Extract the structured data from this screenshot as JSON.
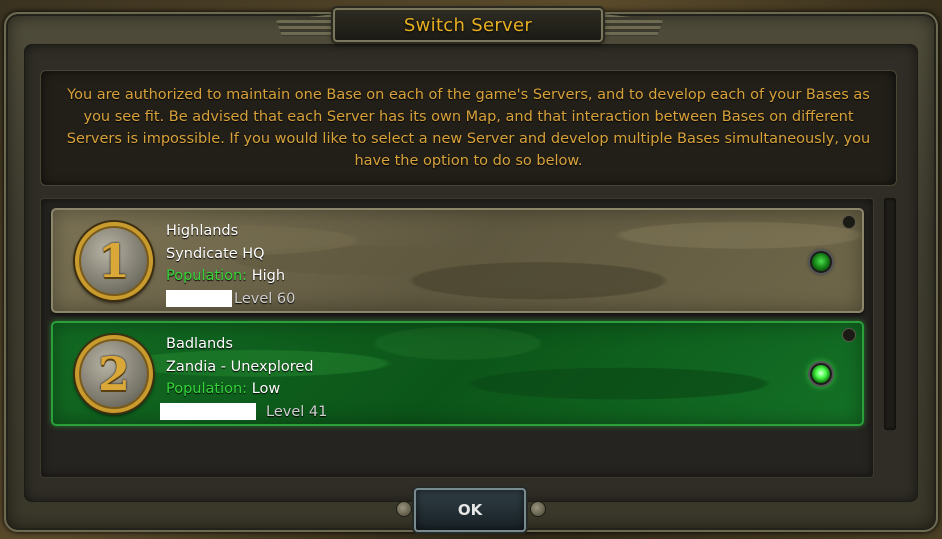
{
  "dialog": {
    "title": "Switch Server",
    "description": "You are authorized to maintain one Base on each of the game's Servers, and to develop each of your Bases as you see fit. Be advised that each Server has its own Map, and that interaction between Bases on different Servers is impossible. If you would like to select a new Server and develop multiple Bases simultaneously, you have the option to do so below."
  },
  "servers": [
    {
      "number": "1",
      "name": "Highlands",
      "base": "Syndicate HQ",
      "population_label": "Population:",
      "population": "High",
      "level": "Level 60",
      "selected": false
    },
    {
      "number": "2",
      "name": "Badlands",
      "base": "Zandia - Unexplored",
      "population_label": "Population:",
      "population": "Low",
      "level": "Level 41",
      "selected": true
    }
  ],
  "ok_label": "OK",
  "colors": {
    "title": "#e8b020",
    "description": "#d8a23a",
    "population_label": "#36d63a",
    "selected_card": "#126a22"
  }
}
